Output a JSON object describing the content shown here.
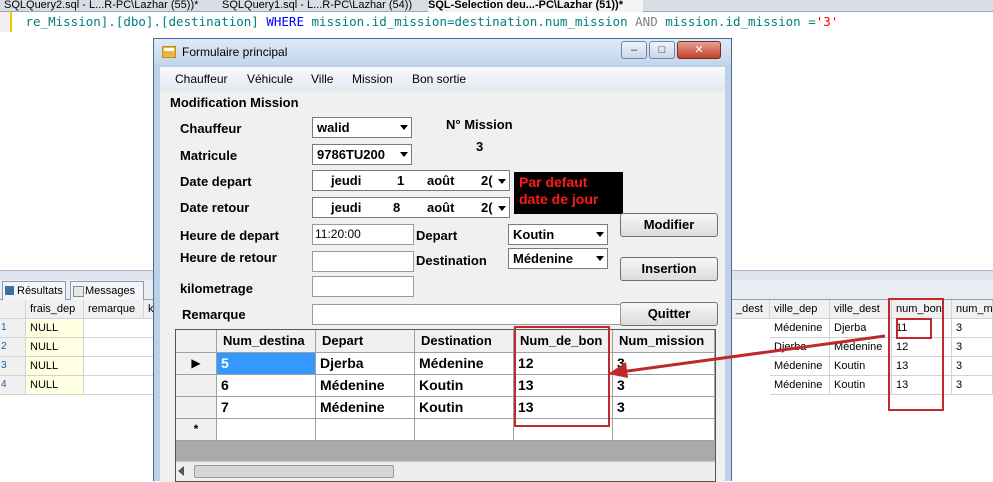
{
  "ssms": {
    "tabs": [
      "SQLQuery2.sql - L...R-PC\\Lazhar (55))*",
      "SQLQuery1.sql - L...R-PC\\Lazhar (54))",
      "SQL-Selection deu...-PC\\Lazhar (51))*"
    ],
    "code": {
      "p1": " re_Mission].[dbo].[destination]",
      "kw_where": "WHERE",
      "p2": " mission.id_mission=destination.num_mission",
      "kw_and": "AND",
      "p3": " mission.id_mission =",
      "str": "'3'"
    },
    "result_tabs": [
      "Résultats",
      "Messages"
    ],
    "grid": {
      "left_headers": [
        "frais_dep",
        "remarque",
        "k"
      ],
      "right_headers": [
        "_dest",
        "ville_dep",
        "ville_dest",
        "num_bon",
        "num_mi"
      ],
      "row_numbers": [
        "1",
        "2",
        "3",
        "4"
      ],
      "left_rows": [
        [
          "NULL"
        ],
        [
          "NULL"
        ],
        [
          "NULL"
        ],
        [
          "NULL"
        ]
      ],
      "right_rows": [
        [
          "Médenine",
          "Djerba",
          "11",
          "3"
        ],
        [
          "Djerba",
          "Médenine",
          "12",
          "3"
        ],
        [
          "Médenine",
          "Koutin",
          "13",
          "3"
        ],
        [
          "Médenine",
          "Koutin",
          "13",
          "3"
        ]
      ]
    }
  },
  "form": {
    "title": "Formulaire principal",
    "menu": [
      "Chauffeur",
      "Véhicule",
      "Ville",
      "Mission",
      "Bon sortie"
    ],
    "section_title": "Modification Mission",
    "labels": {
      "chauffeur": "Chauffeur",
      "matricule": "Matricule",
      "date_depart": "Date depart",
      "date_retour": "Date retour",
      "heure_depart": "Heure de  depart",
      "heure_retour": "Heure de retour",
      "kilometrage": "kilometrage",
      "remarque": "Remarque",
      "depart": "Depart",
      "destination": "Destination",
      "num_mission": "N° Mission"
    },
    "num_mission_value": "3",
    "chauffeur_value": "walid",
    "matricule_value": "9786TU200",
    "date_depart": {
      "day": "jeudi",
      "num": "1",
      "month": "août",
      "year": "2("
    },
    "date_retour": {
      "day": "jeudi",
      "num": "8",
      "month": "août",
      "year": "2("
    },
    "heure_depart_value": "11:20:00",
    "heure_retour_value": "",
    "kilometrage_value": "",
    "remarque_value": "",
    "depart_value": "Koutin",
    "destination_value": "Médenine",
    "note_line1": "Par defaut",
    "note_line2": "date de jour",
    "buttons": {
      "modifier": "Modifier",
      "insertion": "Insertion",
      "quitter": "Quitter"
    },
    "grid": {
      "headers": [
        "Num_destina",
        "Depart",
        "Destination",
        "Num_de_bon",
        "Num_mission"
      ],
      "rows": [
        [
          "5",
          "Djerba",
          "Médenine",
          "12",
          "3"
        ],
        [
          "6",
          "Médenine",
          "Koutin",
          "13",
          "3"
        ],
        [
          "7",
          "Médenine",
          "Koutin",
          "13",
          "3"
        ]
      ],
      "new_row_marker": "*",
      "current_row_marker": "▶"
    }
  },
  "colors": {
    "highlight_red": "#c0292b",
    "selection_blue": "#3399ff",
    "window_frame": "#bcd0e8"
  }
}
